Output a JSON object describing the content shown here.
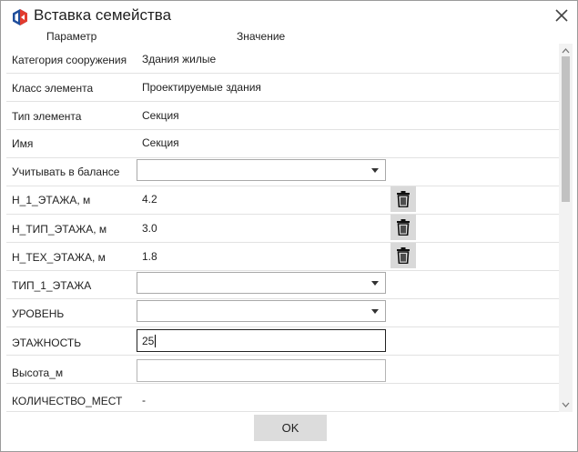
{
  "window": {
    "title": "Вставка семейства"
  },
  "columns": {
    "param": "Параметр",
    "value": "Значение"
  },
  "rows": [
    {
      "label": "Категория сооружения",
      "value": "Здания жилые"
    },
    {
      "label": "Класс элемента",
      "value": "Проектируемые здания"
    },
    {
      "label": "Тип элемента",
      "value": "Секция"
    },
    {
      "label": "Имя",
      "value": "Секция"
    },
    {
      "label": "Учитывать в балансе",
      "value": ""
    },
    {
      "label": "H_1_ЭТАЖА, м",
      "value": "4.2"
    },
    {
      "label": "H_ТИП_ЭТАЖА, м",
      "value": "3.0"
    },
    {
      "label": "H_ТЕХ_ЭТАЖА, м",
      "value": "1.8"
    },
    {
      "label": "ТИП_1_ЭТАЖА",
      "value": ""
    },
    {
      "label": "УРОВЕНЬ",
      "value": ""
    },
    {
      "label": "ЭТАЖНОСТЬ",
      "value": "25"
    },
    {
      "label": "Высота_м",
      "value": ""
    },
    {
      "label": "КОЛИЧЕСТВО_МЕСТ",
      "value": "-"
    }
  ],
  "buttons": {
    "ok": "OK"
  },
  "colors": {
    "logo_blue": "#1f4e9c",
    "logo_red": "#e23b2e",
    "trash_bg": "#d9d9d9"
  },
  "icons": {
    "trash": "trash-icon",
    "close": "close-icon",
    "dropdown": "chevron-down-icon"
  }
}
